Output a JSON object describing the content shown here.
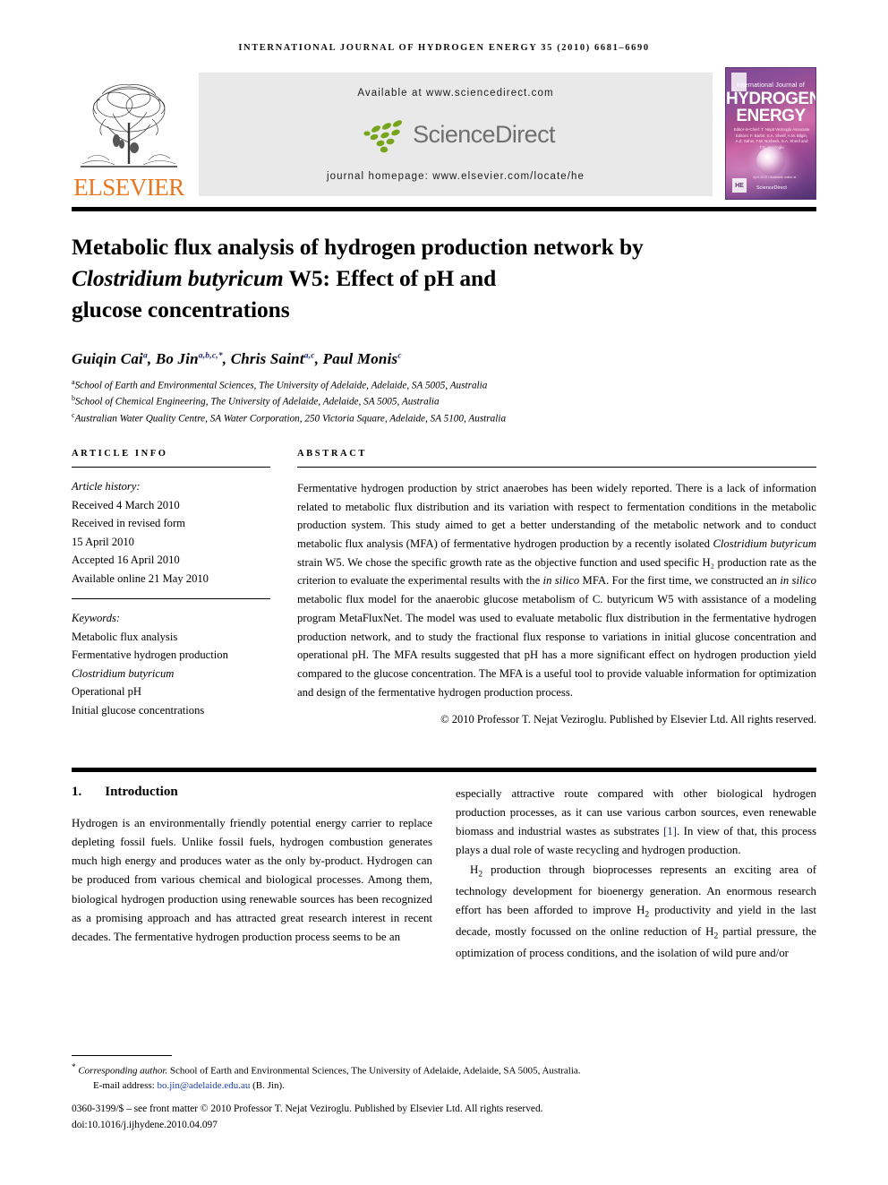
{
  "running_head": "International Journal of Hydrogen Energy 35 (2010) 6681–6690",
  "banner": {
    "publisher": "ELSEVIER",
    "available_at": "Available at www.sciencedirect.com",
    "sciencedirect": "ScienceDirect",
    "homepage": "journal homepage: www.elsevier.com/locate/he",
    "cover": {
      "line_intl": "International Journal of",
      "line1": "HYDROGEN",
      "line2": "ENERGY",
      "editors": "Editor-in-Chief: T. Nejat Veziroglu    Associate Editors: F. Barbir, S.A. Sherif, A.M. Bilgin, A.Z. Sahin, F.M. Norbeck, S.A. Sherif and T.N. Veziroglu",
      "he_badge": "HE",
      "sciencedirect_small": "ScienceDirect",
      "tiny": "April 2010  •  Available online at"
    }
  },
  "title": {
    "line1_a": "Metabolic flux analysis of hydrogen production network by",
    "line2_italic": "Clostridium butyricum",
    "line2_b": " W5: Effect of pH and",
    "line3": "glucose concentrations"
  },
  "authors": [
    {
      "name": "Guiqin Cai",
      "sup": "a"
    },
    {
      "name": "Bo Jin",
      "sup": "a,b,c,*"
    },
    {
      "name": "Chris Saint",
      "sup": "a,c"
    },
    {
      "name": "Paul Monis",
      "sup": "c"
    }
  ],
  "affiliations": [
    {
      "mark": "a",
      "text": "School of Earth and Environmental Sciences, The University of Adelaide, Adelaide, SA 5005, Australia"
    },
    {
      "mark": "b",
      "text": "School of Chemical Engineering, The University of Adelaide, Adelaide, SA 5005, Australia"
    },
    {
      "mark": "c",
      "text": "Australian Water Quality Centre, SA Water Corporation, 250 Victoria Square, Adelaide, SA 5100, Australia"
    }
  ],
  "article_info": {
    "heading": "Article info",
    "history_label": "Article history:",
    "history": [
      "Received 4 March 2010",
      "Received in revised form",
      "15 April 2010",
      "Accepted 16 April 2010",
      "Available online 21 May 2010"
    ],
    "keywords_label": "Keywords:",
    "keywords": [
      "Metabolic flux analysis",
      "Fermentative hydrogen production",
      "Clostridium butyricum",
      "Operational pH",
      "Initial glucose concentrations"
    ]
  },
  "abstract": {
    "heading": "Abstract",
    "p1_a": "Fermentative hydrogen production by strict anaerobes has been widely reported. There is a lack of information related to metabolic flux distribution and its variation with respect to fermentation conditions in the metabolic production system. This study aimed to get a better understanding of the metabolic network and to conduct metabolic flux analysis (MFA) of fermentative hydrogen production by a recently isolated ",
    "p1_it1": "Clostridium butyricum",
    "p1_b": " strain W5. We chose the specific growth rate as the objective function and used specific H₂ production rate as the criterion to evaluate the experimental results with the ",
    "p1_it2": "in silico",
    "p1_c": " MFA. For the first time, we constructed an ",
    "p1_it3": "in silico",
    "p1_d": " metabolic flux model for the anaerobic glucose metabolism of C. butyricum W5 with assistance of a modeling program MetaFluxNet. The model was used to evaluate metabolic flux distribution in the fermentative hydrogen production network, and to study the fractional flux response to variations in initial glucose concentration and operational pH. The MFA results suggested that pH has a more significant effect on hydrogen production yield compared to the glucose concentration. The MFA is a useful tool to provide valuable information for optimization and design of the fermentative hydrogen production process.",
    "copyright": "© 2010 Professor T. Nejat Veziroglu. Published by Elsevier Ltd. All rights reserved."
  },
  "body": {
    "section_number": "1.",
    "section_title": "Introduction",
    "left_p1": "Hydrogen is an environmentally friendly potential energy carrier to replace depleting fossil fuels. Unlike fossil fuels, hydrogen combustion generates much high energy and produces water as the only by-product. Hydrogen can be produced from various chemical and biological processes. Among them, biological hydrogen production using renewable sources has been recognized as a promising approach and has attracted great research interest in recent decades. The fermentative hydrogen production process seems to be an",
    "right_p1_a": "especially attractive route compared with other biological hydrogen production processes, as it can use various carbon sources, even renewable biomass and industrial wastes as substrates ",
    "right_p1_ref": "[1]",
    "right_p1_b": ". In view of that, this process plays a dual role of waste recycling and hydrogen production.",
    "right_p2_a": "H",
    "right_p2_sub": "2",
    "right_p2_b": " production through bioprocesses represents an exciting area of technology development for bioenergy generation. An enormous research effort has been afforded to improve H",
    "right_p2_sub2": "2",
    "right_p2_c": " productivity and yield in the last decade, mostly focussed on the online reduction of H",
    "right_p2_sub3": "2",
    "right_p2_d": " partial pressure, the optimization of process conditions, and the isolation of wild pure and/or"
  },
  "footer": {
    "corresponding_mark": "*",
    "corresponding_label": "Corresponding author.",
    "corresponding_text": " School of Earth and Environmental Sciences, The University of Adelaide, Adelaide, SA 5005, Australia.",
    "email_label": "E-mail address: ",
    "email": "bo.jin@adelaide.edu.au",
    "email_suffix": " (B. Jin).",
    "issn_line": "0360-3199/$ – see front matter © 2010 Professor T. Nejat Veziroglu. Published by Elsevier Ltd. All rights reserved.",
    "doi_line": "doi:10.1016/j.ijhydene.2010.04.097"
  },
  "colors": {
    "elsevier_orange": "#E87722",
    "link_blue": "#1b3fa8",
    "sup_navy": "#1b2a6b",
    "sd_gray": "#e9e9e9"
  }
}
